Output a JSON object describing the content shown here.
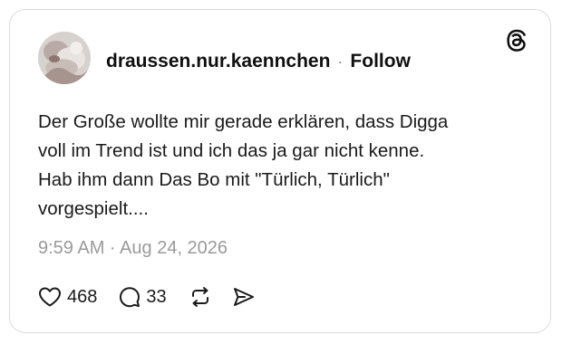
{
  "post": {
    "username": "draussen.nur.kaennchen",
    "separator": "·",
    "follow_label": "Follow",
    "text_lines": [
      "Der Große wollte mir gerade erklären, dass Digga",
      "voll im Trend ist und ich das ja gar nicht kenne.",
      "Hab ihm dann Das Bo mit \"Türlich, Türlich\"",
      "vorgespielt...."
    ],
    "timestamp": "9:59 AM · Aug 24, 2026",
    "likes": "468",
    "replies": "33"
  },
  "icons": {
    "logo": "threads-logo-icon",
    "like": "heart-icon",
    "reply": "speech-bubble-icon",
    "repost": "repost-icon",
    "share": "send-icon"
  }
}
